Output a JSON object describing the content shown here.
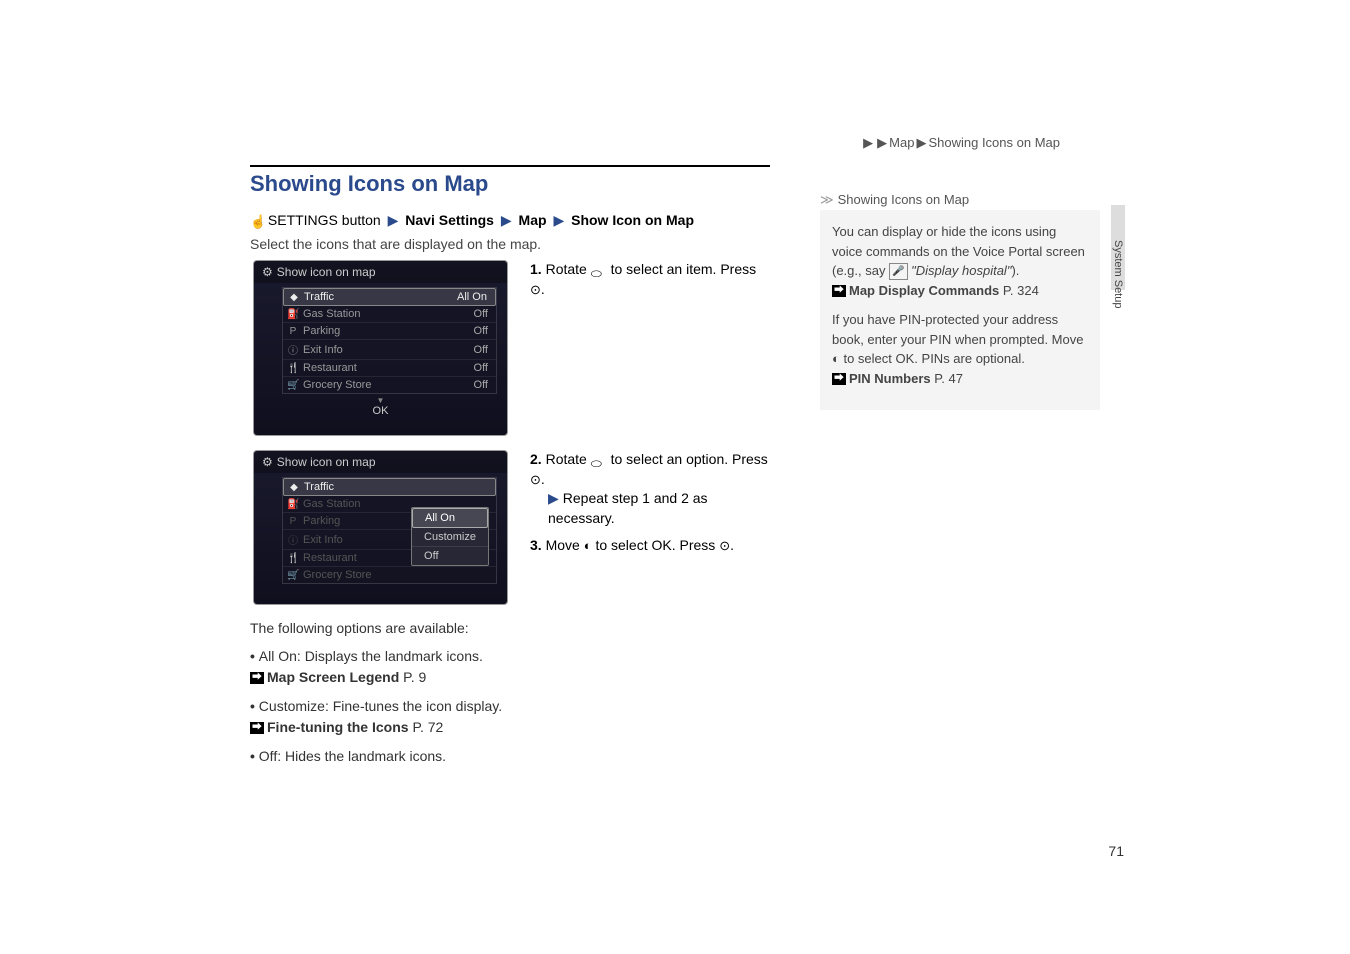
{
  "breadcrumb": {
    "parts": [
      "",
      "Map",
      "Showing Icons on Map"
    ]
  },
  "section_title": "Showing Icons on Map",
  "settings_path": {
    "prefix": "SETTINGS button",
    "parts": [
      "Navi Settings",
      "Map",
      "Show Icon on Map"
    ]
  },
  "instruction": "Select the icons that are displayed on the map.",
  "screen1": {
    "title": "Show icon on map",
    "rows": [
      {
        "icon": "◆",
        "label": "Traffic",
        "state": "All On",
        "selected": true
      },
      {
        "icon": "⛽",
        "label": "Gas Station",
        "state": "Off",
        "selected": false
      },
      {
        "icon": "P",
        "label": "Parking",
        "state": "Off",
        "selected": false
      },
      {
        "icon": "ⓘ",
        "label": "Exit Info",
        "state": "Off",
        "selected": false
      },
      {
        "icon": "🍴",
        "label": "Restaurant",
        "state": "Off",
        "selected": false
      },
      {
        "icon": "🛒",
        "label": "Grocery Store",
        "state": "Off",
        "selected": false
      }
    ],
    "ok": "OK"
  },
  "screen2": {
    "title": "Show icon on map",
    "rows": [
      {
        "icon": "◆",
        "label": "Traffic",
        "selected": true,
        "dim": false
      },
      {
        "icon": "⛽",
        "label": "Gas Station",
        "selected": false,
        "dim": true
      },
      {
        "icon": "P",
        "label": "Parking",
        "selected": false,
        "dim": true
      },
      {
        "icon": "ⓘ",
        "label": "Exit Info",
        "selected": false,
        "dim": true
      },
      {
        "icon": "🍴",
        "label": "Restaurant",
        "selected": false,
        "dim": true
      },
      {
        "icon": "🛒",
        "label": "Grocery Store",
        "selected": false,
        "dim": true
      }
    ],
    "submenu": [
      {
        "label": "All On",
        "selected": true
      },
      {
        "label": "Customize",
        "selected": false
      },
      {
        "label": "Off",
        "selected": false
      }
    ]
  },
  "steps": {
    "s1": {
      "num": "1.",
      "text_a": "Rotate ",
      "text_b": " to select an item. Press ",
      "text_c": "."
    },
    "s2": {
      "num": "2.",
      "text_a": "Rotate ",
      "text_b": " to select an option. Press ",
      "text_c": "."
    },
    "s2_sub": "Repeat step 1 and 2 as necessary.",
    "s3": {
      "num": "3.",
      "text_a": "Move ",
      "text_b": " to select ",
      "ok": "OK",
      "text_c": ". Press ",
      "text_d": "."
    }
  },
  "options": {
    "intro": "The following options are available:",
    "items": [
      {
        "name": "All On",
        "desc": ": Displays the landmark icons.",
        "link_label": "Map Screen Legend",
        "link_page": "P. 9"
      },
      {
        "name": "Customize",
        "desc": ": Fine-tunes the icon display.",
        "link_label": "Fine-tuning the Icons",
        "link_page": "P. 72"
      },
      {
        "name": "Off",
        "desc": ": Hides the landmark icons.",
        "link_label": "",
        "link_page": ""
      }
    ]
  },
  "sidebar": {
    "title": "Showing Icons on Map",
    "p1a": "You can display or hide the icons using voice commands on the Voice Portal screen (e.g., say ",
    "p1_voice": "\"Display hospital\"",
    "p1b": ").",
    "link1_label": "Map Display Commands",
    "link1_page": "P. 324",
    "p2a": "If you have PIN-protected your address book, enter your PIN when prompted. Move ",
    "p2b": " to select ",
    "p2_ok": "OK",
    "p2c": ". PINs are optional.",
    "link2_label": "PIN Numbers",
    "link2_page": "P. 47"
  },
  "side_label": "System Setup",
  "page_number": "71"
}
